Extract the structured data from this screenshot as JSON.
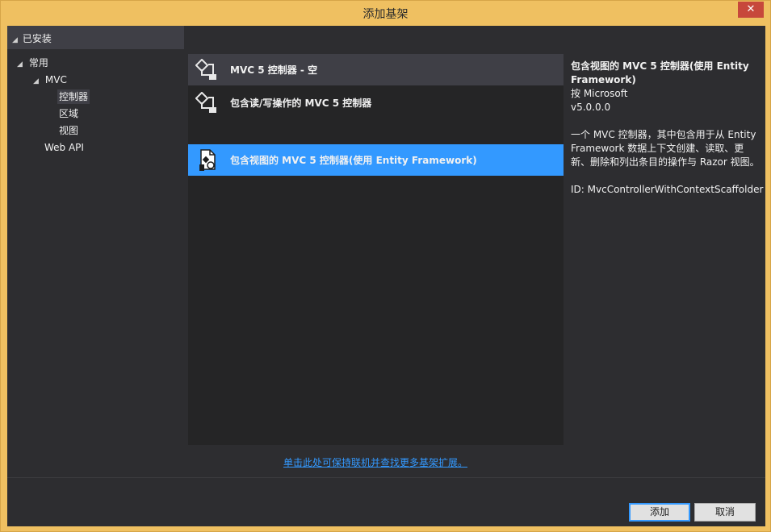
{
  "window": {
    "title": "添加基架",
    "close_glyph": "✕"
  },
  "tree": {
    "header_label": "已安装",
    "items": [
      {
        "label": "常用",
        "expander": "◢"
      },
      {
        "label": "MVC",
        "expander": "◢"
      },
      {
        "label": "控制器"
      },
      {
        "label": "区域"
      },
      {
        "label": "视图"
      },
      {
        "label": "Web API"
      }
    ]
  },
  "templates": [
    {
      "label": "MVC 5 控制器 - 空",
      "icon": "controller-icon"
    },
    {
      "label": "包含读/写操作的 MVC 5 控制器",
      "icon": "controller-icon"
    },
    {
      "label": "包含视图的 MVC 5 控制器(使用 Entity Framework)",
      "icon": "controller-with-views-icon"
    }
  ],
  "details": {
    "title": "包含视图的 MVC 5 控制器(使用 Entity Framework)",
    "author": "按 Microsoft",
    "version": "v5.0.0.0",
    "description": "一个 MVC 控制器，其中包含用于从 Entity Framework 数据上下文创建、读取、更新、删除和列出条目的操作与 Razor 视图。",
    "id": "ID: MvcControllerWithContextScaffolder"
  },
  "online_link": "单击此处可保持联机并查找更多基架扩展。",
  "buttons": {
    "add": "添加",
    "cancel": "取消"
  },
  "colors": {
    "accent": "#3399ff",
    "titlebar": "#efc061",
    "background": "#2d2d30",
    "close": "#c7483b"
  }
}
